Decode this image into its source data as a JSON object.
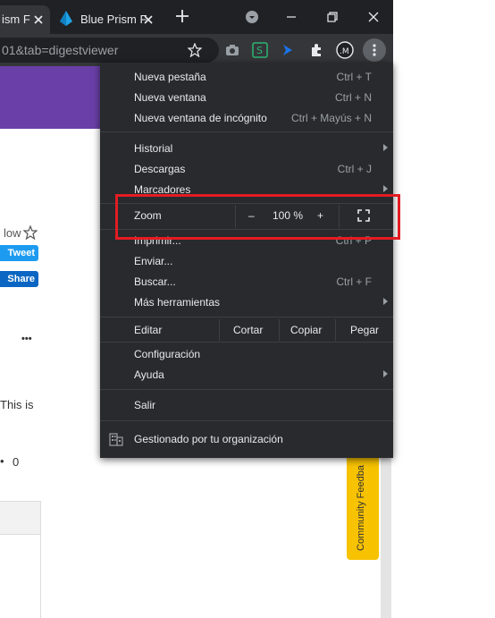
{
  "tabs": [
    {
      "title": "ism F",
      "active": true
    },
    {
      "title": "Blue Prism F",
      "active": false
    }
  ],
  "address_bar": {
    "url": "01&tab=digestviewer"
  },
  "page": {
    "follow_text": "low",
    "tweet_label": "Tweet",
    "share_label": "Share",
    "more_text": "•••",
    "body_text": "This is",
    "count_text": "0",
    "feedback_label": "Community Feedba"
  },
  "menu": {
    "items_top": [
      {
        "label": "Nueva pestaña",
        "shortcut": "Ctrl + T"
      },
      {
        "label": "Nueva ventana",
        "shortcut": "Ctrl + N"
      },
      {
        "label": "Nueva ventana de incógnito",
        "shortcut": "Ctrl + Mayús + N"
      }
    ],
    "items_history": [
      {
        "label": "Historial",
        "shortcut": ""
      },
      {
        "label": "Descargas",
        "shortcut": "Ctrl + J"
      },
      {
        "label": "Marcadores",
        "shortcut": ""
      }
    ],
    "zoom": {
      "label": "Zoom",
      "minus": "–",
      "value": "100 %",
      "plus": "+"
    },
    "items_tools": [
      {
        "label": "Imprimir...",
        "shortcut": "Ctrl + P"
      },
      {
        "label": "Enviar...",
        "shortcut": ""
      },
      {
        "label": "Buscar...",
        "shortcut": "Ctrl + F"
      },
      {
        "label": "Más herramientas",
        "shortcut": ""
      }
    ],
    "edit": {
      "label": "Editar",
      "cut": "Cortar",
      "copy": "Copiar",
      "paste": "Pegar"
    },
    "items_settings": [
      {
        "label": "Configuración"
      },
      {
        "label": "Ayuda"
      }
    ],
    "exit_label": "Salir",
    "managed_label": "Gestionado por tu organización"
  },
  "colors": {
    "highlight": "#e31c23",
    "menu_bg": "#292a2d",
    "banner": "#6a40a8",
    "feedback": "#f7c200"
  }
}
